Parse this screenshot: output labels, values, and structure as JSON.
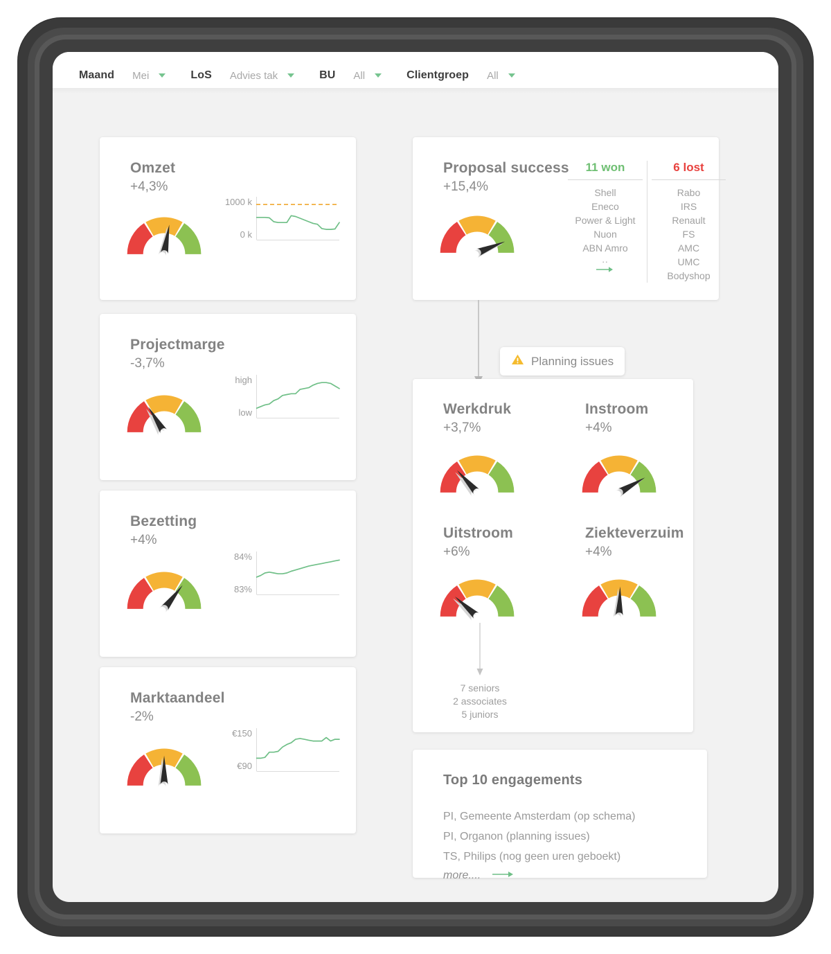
{
  "filters": [
    {
      "name": "Maand",
      "value": "Mei",
      "icon": "chevron-down-icon"
    },
    {
      "name": "LoS",
      "value": "Advies tak",
      "icon": "chevron-down-icon"
    },
    {
      "name": "BU",
      "value": "All",
      "icon": "chevron-down-icon"
    },
    {
      "name": "Clientgroep",
      "value": "All",
      "icon": "chevron-down-icon"
    }
  ],
  "colors": {
    "red": "#e8423f",
    "amber": "#f5b335",
    "green": "#8cc152",
    "needle": "#2b2b2b",
    "spark_line": "#6fbf87",
    "target_line": "#f0a830",
    "won": "#6fbf73",
    "lost": "#e8423f"
  },
  "cards": {
    "omzet": {
      "title": "Omzet",
      "delta": "+4,3%",
      "gauge": {
        "needle_angle": 100,
        "zones": [
          "red",
          "amber",
          "green"
        ]
      },
      "spark": {
        "label_top": "1000 k",
        "label_bottom": "0 k",
        "target_line": true,
        "values": [
          52,
          52,
          52,
          51,
          42,
          40,
          40,
          40,
          56,
          54,
          50,
          46,
          42,
          38,
          36,
          26,
          24,
          24,
          25,
          40
        ]
      }
    },
    "projectmarge": {
      "title": "Projectmarge",
      "delta": "-3,7%",
      "gauge": {
        "needle_angle": 58,
        "zones": [
          "red",
          "amber",
          "green"
        ]
      },
      "spark": {
        "label_top": "high",
        "label_bottom": "low",
        "target_line": false,
        "values": [
          22,
          26,
          30,
          32,
          40,
          44,
          52,
          54,
          56,
          56,
          66,
          68,
          70,
          76,
          80,
          82,
          82,
          80,
          74,
          68
        ]
      }
    },
    "bezetting": {
      "title": "Bezetting",
      "delta": "+4%",
      "gauge": {
        "needle_angle": 128,
        "zones": [
          "red",
          "amber",
          "green"
        ]
      },
      "spark": {
        "label_top": "84%",
        "label_bottom": "83%",
        "target_line": false,
        "values": [
          40,
          44,
          50,
          52,
          50,
          48,
          48,
          50,
          54,
          57,
          60,
          63,
          66,
          68,
          70,
          72,
          74,
          76,
          78,
          80
        ]
      }
    },
    "marktaandeel": {
      "title": "Marktaandeel",
      "delta": "-2%",
      "gauge": {
        "needle_angle": 90,
        "zones": [
          "red",
          "amber",
          "green"
        ]
      },
      "spark": {
        "label_top": "€150",
        "label_bottom": "€90",
        "target_line": false,
        "values": [
          30,
          30,
          32,
          44,
          44,
          46,
          56,
          62,
          66,
          74,
          76,
          74,
          72,
          70,
          70,
          70,
          78,
          70,
          74,
          74
        ]
      }
    },
    "proposal": {
      "title": "Proposal success",
      "delta": "+15,4%",
      "gauge": {
        "needle_angle": 158,
        "zones": [
          "red",
          "amber",
          "green"
        ]
      },
      "won": {
        "header": "11 won",
        "items": [
          "Shell",
          "Eneco",
          "Power & Light",
          "Nuon",
          "ABN Amro"
        ],
        "ellipsis": "..",
        "more_icon": "arrow-right-icon"
      },
      "lost": {
        "header": "6 lost",
        "items": [
          "Rabo",
          "IRS",
          "Renault",
          "FS",
          "AMC",
          "UMC",
          "Bodyshop"
        ]
      }
    },
    "planning_issues": {
      "label": "Planning issues",
      "icon": "warning-triangle-icon"
    },
    "hr": {
      "metrics": [
        {
          "title": "Werkdruk",
          "delta": "+3,7%",
          "gauge": {
            "needle_angle": 48
          }
        },
        {
          "title": "Instroom",
          "delta": "+4%",
          "gauge": {
            "needle_angle": 150
          }
        },
        {
          "title": "Uitstroom",
          "delta": "+6%",
          "gauge": {
            "needle_angle": 42
          }
        },
        {
          "title": "Ziekteverzuim",
          "delta": "+4%",
          "gauge": {
            "needle_angle": 92
          }
        }
      ],
      "uitstroom_breakdown": [
        "7 seniors",
        "2 associates",
        "5 juniors"
      ]
    },
    "engagements": {
      "title": "Top 10 engagements",
      "items": [
        "PI, Gemeente Amsterdam (op schema)",
        "PI, Organon (planning issues)",
        "TS, Philips (nog geen uren geboekt)"
      ],
      "more_label": "more....",
      "more_icon": "arrow-right-icon"
    }
  }
}
